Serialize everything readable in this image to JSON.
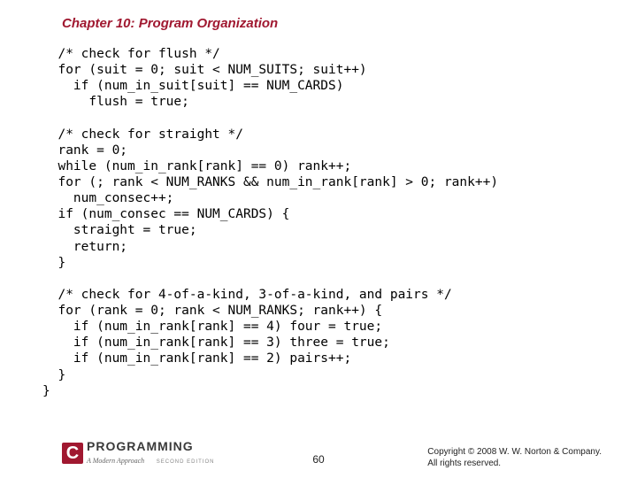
{
  "header": {
    "title": "Chapter 10: Program Organization"
  },
  "code": "  /* check for flush */\n  for (suit = 0; suit < NUM_SUITS; suit++)\n    if (num_in_suit[suit] == NUM_CARDS)\n      flush = true;\n\n  /* check for straight */\n  rank = 0;\n  while (num_in_rank[rank] == 0) rank++;\n  for (; rank < NUM_RANKS && num_in_rank[rank] > 0; rank++)\n    num_consec++;\n  if (num_consec == NUM_CARDS) {\n    straight = true;\n    return;\n  }\n\n  /* check for 4-of-a-kind, 3-of-a-kind, and pairs */\n  for (rank = 0; rank < NUM_RANKS; rank++) {\n    if (num_in_rank[rank] == 4) four = true;\n    if (num_in_rank[rank] == 3) three = true;\n    if (num_in_rank[rank] == 2) pairs++;\n  }\n}",
  "footer": {
    "logo_c": "C",
    "logo_main": "PROGRAMMING",
    "logo_sub": "A Modern Approach",
    "logo_edition": "SECOND EDITION",
    "page_number": "60",
    "copyright_line1": "Copyright © 2008 W. W. Norton & Company.",
    "copyright_line2": "All rights reserved."
  }
}
